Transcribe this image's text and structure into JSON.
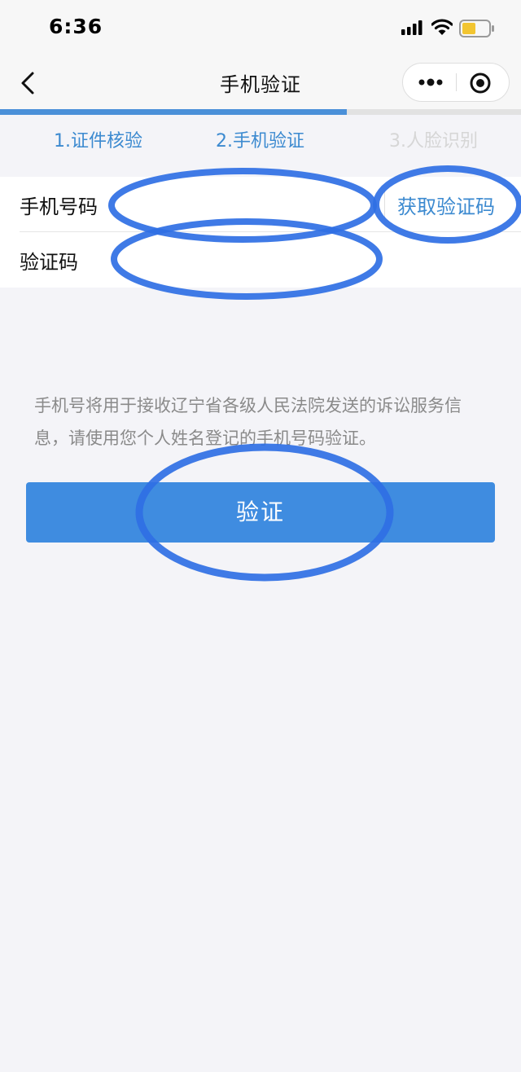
{
  "status_bar": {
    "time": "6:36"
  },
  "nav": {
    "title": "手机验证"
  },
  "progress": {
    "fraction": 0.665
  },
  "steps": [
    {
      "label": "1.证件核验",
      "active": true
    },
    {
      "label": "2.手机验证",
      "active": true
    },
    {
      "label": "3.人脸识别",
      "active": false
    }
  ],
  "form": {
    "phone_label": "手机号码",
    "phone_value": "",
    "get_code_label": "获取验证码",
    "code_label": "验证码",
    "code_value": ""
  },
  "notice": "手机号将用于接收辽宁省各级人民法院发送的诉讼服务信息，请使用您个人姓名登记的手机号码验证。",
  "verify_button_label": "验证",
  "colors": {
    "accent": "#3f8ce0",
    "step_active": "#3c8ad0",
    "step_inactive": "#d6d6d6",
    "annotation_ring": "#2f6fe4"
  }
}
